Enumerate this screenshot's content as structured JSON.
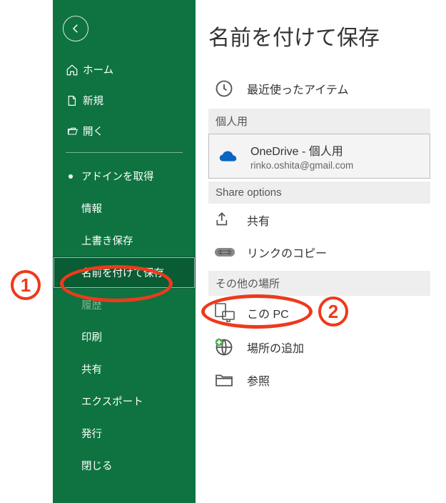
{
  "pageTitle": "名前を付けて保存",
  "sidebar": {
    "home": "ホーム",
    "new": "新規",
    "open": "開く",
    "items": [
      "アドインを取得",
      "情報",
      "上書き保存",
      "名前を付けて保存",
      "履歴",
      "印刷",
      "共有",
      "エクスポート",
      "発行",
      "閉じる"
    ]
  },
  "main": {
    "recent": "最近使ったアイテム",
    "personal": "個人用",
    "onedrive": {
      "title": "OneDrive - 個人用",
      "email": "rinko.oshita@gmail.com"
    },
    "shareOptions": "Share options",
    "share": "共有",
    "copyLink": "リンクのコピー",
    "otherLocations": "その他の場所",
    "thisPC": "この PC",
    "addPlace": "場所の追加",
    "browse": "参照"
  },
  "annotations": {
    "one": "1",
    "two": "2"
  }
}
